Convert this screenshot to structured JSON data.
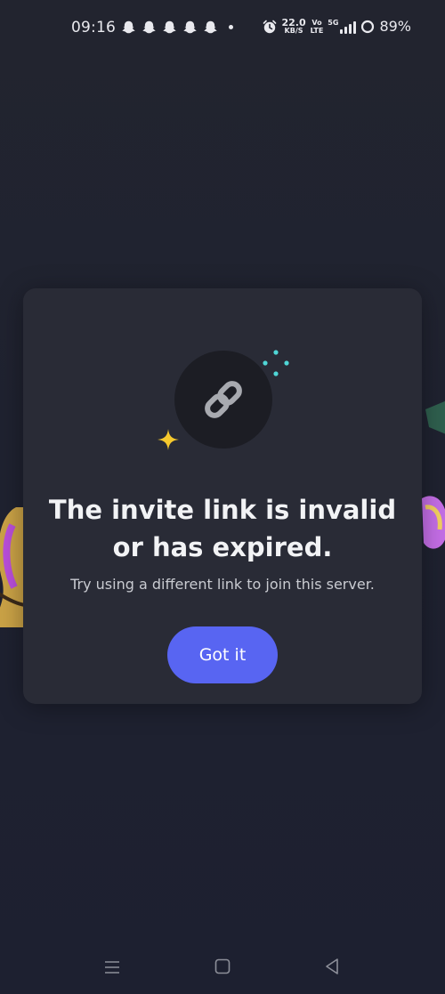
{
  "status_bar": {
    "time": "09:16",
    "notification_icons": [
      "snapchat-icon",
      "snapchat-icon",
      "snapchat-icon",
      "snapchat-icon",
      "snapchat-icon"
    ],
    "net_speed_value": "22.0",
    "net_speed_unit": "KB/S",
    "volte_top": "Vo",
    "volte_bottom": "LTE",
    "network_type": "5G",
    "battery_percent": "89%"
  },
  "modal": {
    "icon": "link-icon",
    "title": "The invite link is invalid or has expired.",
    "subtitle": "Try using a different link to join this server.",
    "button_label": "Got it",
    "colors": {
      "button": "#5865f2",
      "background": "#292b36",
      "sparkle_yellow": "#f5c82d",
      "sparkle_cyan": "#4fd6d6"
    }
  },
  "nav_bar": {
    "icons": [
      "menu-icon",
      "home-icon",
      "back-icon"
    ]
  }
}
